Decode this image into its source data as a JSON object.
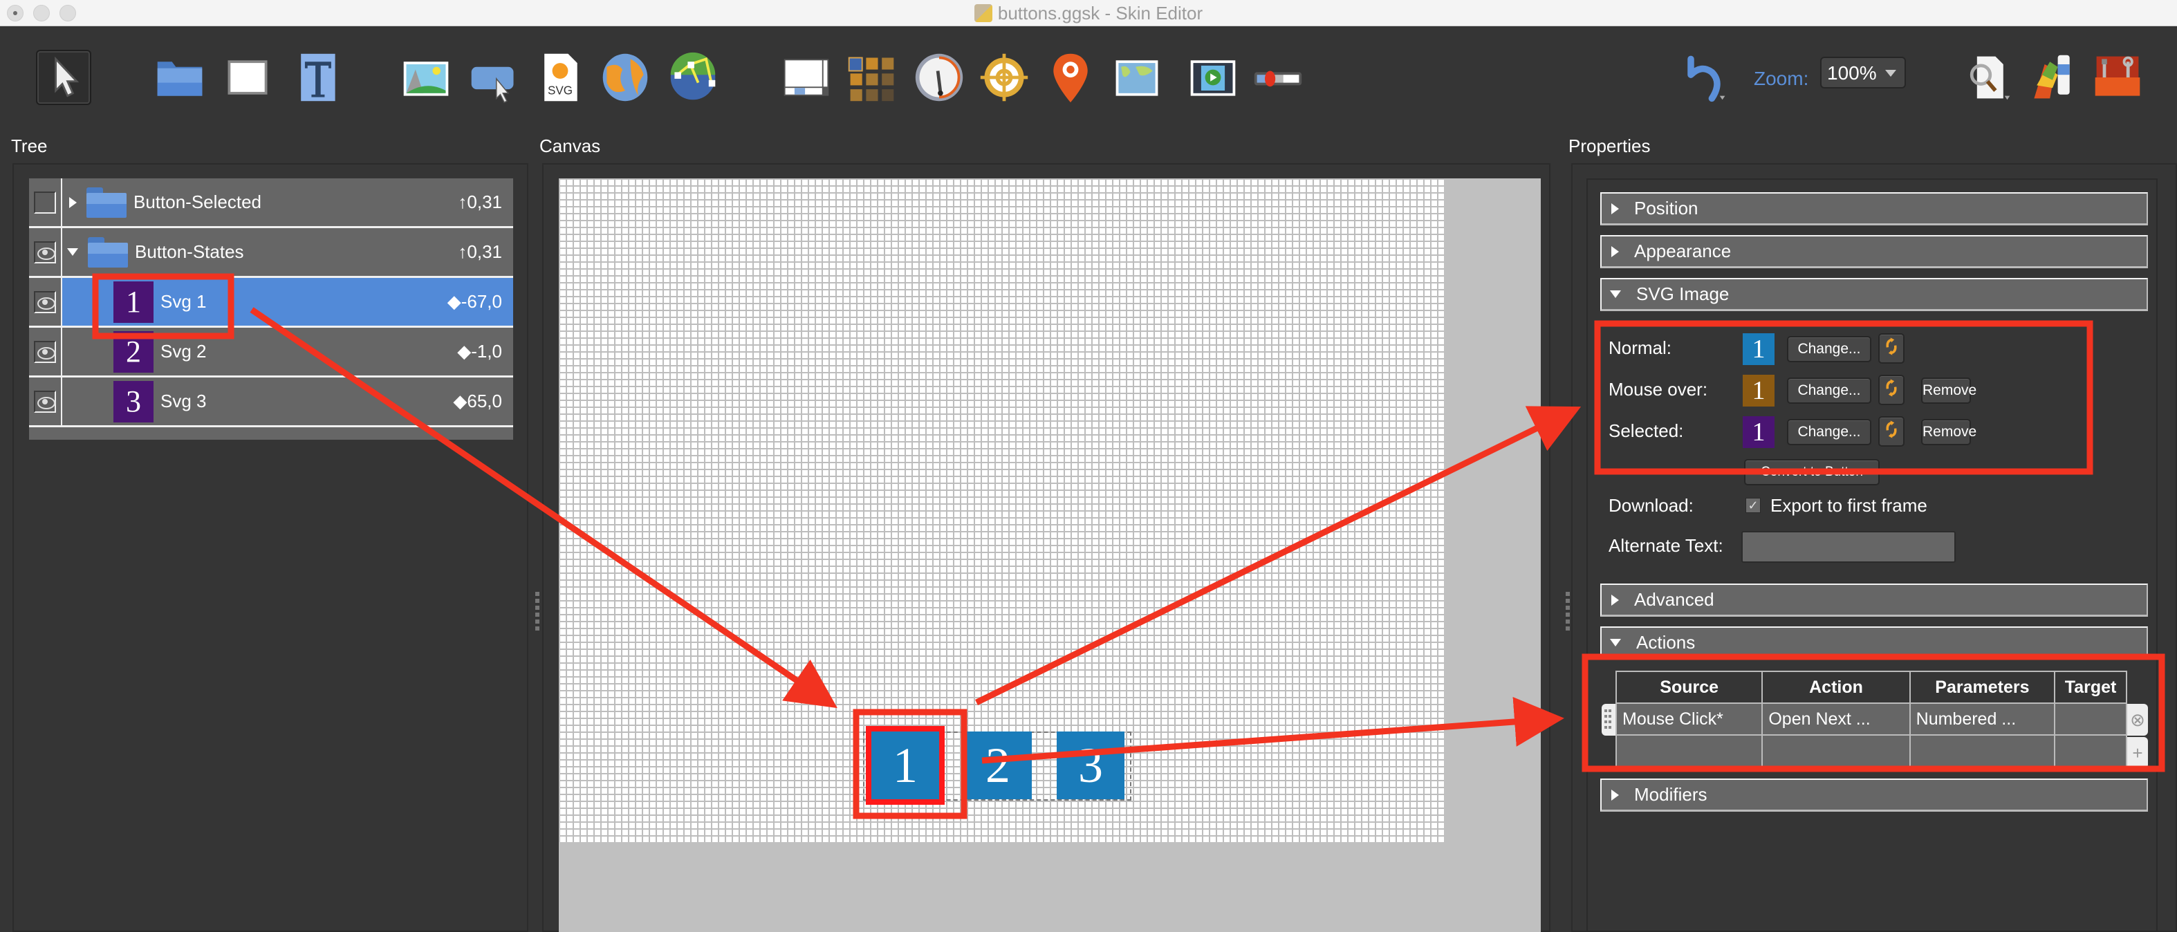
{
  "window": {
    "title": "buttons.ggsk - Skin Editor"
  },
  "toolbar": {
    "tools": [
      {
        "name": "pointer-tool",
        "icon": "pointer-icon"
      },
      {
        "name": "folder-tool",
        "icon": "folder-icon"
      },
      {
        "name": "rectangle-tool",
        "icon": "rectangle-icon"
      },
      {
        "name": "text-tool",
        "icon": "text-icon"
      },
      {
        "name": "image-tool",
        "icon": "image-icon"
      },
      {
        "name": "button-tool",
        "icon": "button-icon"
      },
      {
        "name": "svg-tool",
        "icon": "svg-icon"
      },
      {
        "name": "map-globe-tool",
        "icon": "globe-icon"
      },
      {
        "name": "node-globe-tool",
        "icon": "node-globe-icon"
      },
      {
        "name": "scrollarea-tool",
        "icon": "scrollarea-icon"
      },
      {
        "name": "cloner-tool",
        "icon": "cloner-grid-icon"
      },
      {
        "name": "compass-tool",
        "icon": "gauge-icon"
      },
      {
        "name": "hotspot-tool",
        "icon": "target-icon"
      },
      {
        "name": "map-pin-tool",
        "icon": "map-pin-icon"
      },
      {
        "name": "map-tool",
        "icon": "map-icon"
      },
      {
        "name": "video-tool",
        "icon": "video-icon"
      },
      {
        "name": "slider-tool",
        "icon": "slider-icon"
      }
    ],
    "svg_label": "SVG",
    "zoom_label": "Zoom:",
    "zoom_value": "100%"
  },
  "panels": {
    "tree": "Tree",
    "canvas": "Canvas",
    "properties": "Properties"
  },
  "tree": {
    "rows": [
      {
        "name": "Button-Selected",
        "value": "↑0,31",
        "type": "folder",
        "expanded": false,
        "visible": false
      },
      {
        "name": "Button-States",
        "value": "↑0,31",
        "type": "folder",
        "expanded": true,
        "visible": true
      },
      {
        "name": "Svg 1",
        "value": "◆-67,0",
        "type": "svg",
        "thumb": "1",
        "selected": true,
        "visible": true
      },
      {
        "name": "Svg 2",
        "value": "◆-1,0",
        "type": "svg",
        "thumb": "2",
        "visible": true
      },
      {
        "name": "Svg 3",
        "value": "◆65,0",
        "type": "svg",
        "thumb": "3",
        "visible": true
      }
    ]
  },
  "canvas": {
    "buttons": [
      "1",
      "2",
      "3"
    ],
    "button_color": "#1a7cba"
  },
  "properties": {
    "sections": {
      "position": "Position",
      "appearance": "Appearance",
      "svg_image": "SVG Image",
      "advanced": "Advanced",
      "actions": "Actions",
      "modifiers": "Modifiers"
    },
    "svg_states": [
      {
        "label": "Normal:",
        "thumb": "1",
        "color": "#1a7cba",
        "change": "Change...",
        "remove": null
      },
      {
        "label": "Mouse over:",
        "thumb": "1",
        "color": "#8c5a12",
        "change": "Change...",
        "remove": "Remove"
      },
      {
        "label": "Selected:",
        "thumb": "1",
        "color": "#4a1473",
        "change": "Change...",
        "remove": "Remove"
      }
    ],
    "convert_button": "Convert to Button",
    "download_label": "Download:",
    "export_first_frame": "Export to first frame",
    "export_checked": true,
    "alt_text_label": "Alternate Text:",
    "alt_text_value": "",
    "actions_table": {
      "headers": [
        "Source",
        "Action",
        "Parameters",
        "Target"
      ],
      "rows": [
        [
          "Mouse Click*",
          "Open Next ...",
          "Numbered ...",
          ""
        ],
        [
          "",
          "",
          "",
          ""
        ]
      ]
    }
  }
}
